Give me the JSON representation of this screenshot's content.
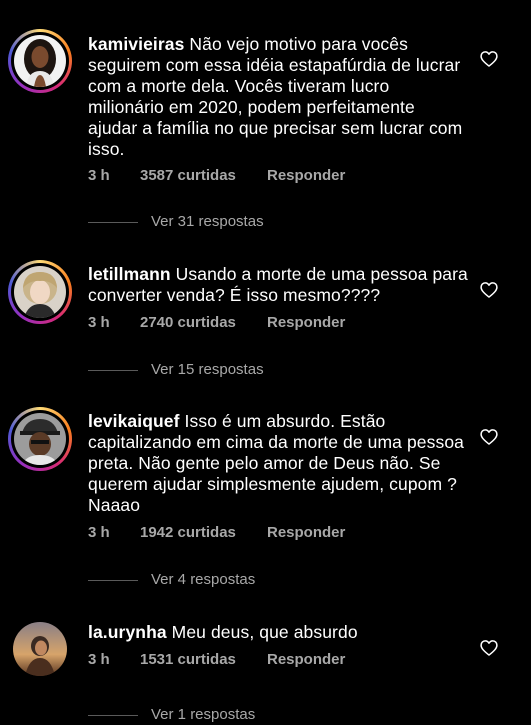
{
  "comments": [
    {
      "username": "kamivieiras",
      "text": "Não vejo motivo para vocês seguirem com essa idéia estapafúrdia de lucrar com a morte dela. Vocês tiveram lucro milionário em 2020, podem perfeitamente ajudar a família no que precisar sem lucrar com isso.",
      "time": "3 h",
      "likes": "3587 curtidas",
      "reply_label": "Responder",
      "view_replies": "Ver 31 respostas",
      "avatar_icon": "avatar-woman-dark-hair",
      "has_story_ring": true
    },
    {
      "username": "letillmann",
      "text": "Usando a morte de uma pessoa para converter venda? É isso mesmo????",
      "time": "3 h",
      "likes": "2740 curtidas",
      "reply_label": "Responder",
      "view_replies": "Ver 15 respostas",
      "avatar_icon": "avatar-woman-blonde",
      "has_story_ring": true
    },
    {
      "username": "levikaiquef",
      "text": "Isso é um absurdo. Estão capitalizando em cima da morte de uma pessoa preta. Não gente pelo amor de Deus não. Se querem ajudar simplesmente ajudem, cupom ? Naaao",
      "time": "3 h",
      "likes": "1942 curtidas",
      "reply_label": "Responder",
      "view_replies": "Ver 4 respostas",
      "avatar_icon": "avatar-man-hat",
      "has_story_ring": true
    },
    {
      "username": "la.urynha",
      "text": "Meu deus, que absurdo",
      "time": "3 h",
      "likes": "1531 curtidas",
      "reply_label": "Responder",
      "view_replies": "Ver 1 respostas",
      "avatar_icon": "avatar-woman-sunset",
      "has_story_ring": false
    }
  ],
  "colors": {
    "background": "#000000",
    "text": "#ffffff",
    "meta": "#a8a8a8"
  },
  "icons": {
    "like": "heart-outline-icon"
  }
}
